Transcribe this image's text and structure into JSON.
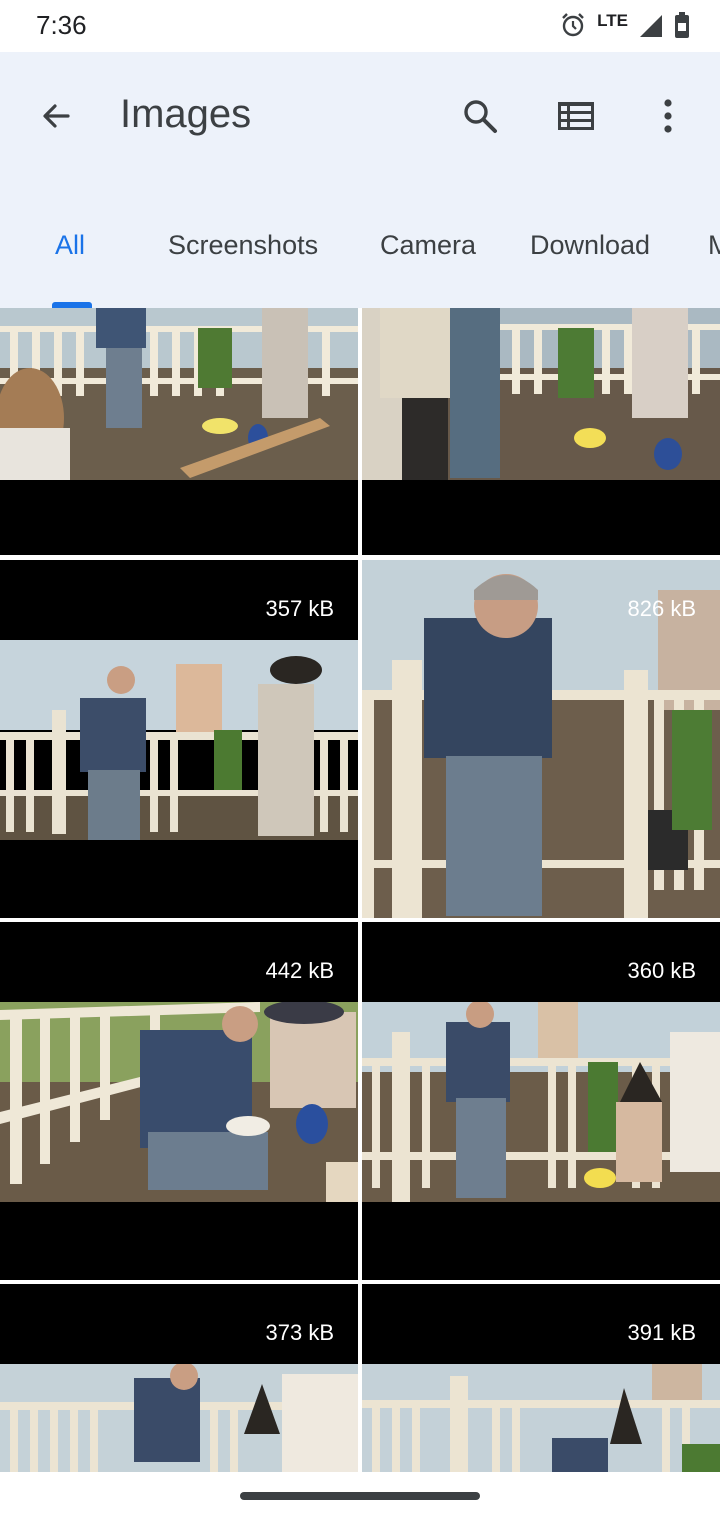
{
  "status_bar": {
    "time": "7:36",
    "network": "LTE"
  },
  "app_bar": {
    "title": "Images",
    "icons": [
      "back-arrow-icon",
      "search-icon",
      "list-view-icon",
      "more-vert-icon"
    ]
  },
  "tabs": [
    {
      "label": "All",
      "active": true
    },
    {
      "label": "Screenshots",
      "active": false
    },
    {
      "label": "Camera",
      "active": false
    },
    {
      "label": "Download",
      "active": false
    },
    {
      "label": "M",
      "active": false
    }
  ],
  "images": [
    {
      "size": ""
    },
    {
      "size": ""
    },
    {
      "size": "357 kB"
    },
    {
      "size": "826 kB"
    },
    {
      "size": "442 kB"
    },
    {
      "size": "360 kB"
    },
    {
      "size": "373 kB"
    },
    {
      "size": "391 kB"
    }
  ],
  "colors": {
    "accent": "#1a73e8",
    "header_bg": "#edf2fa",
    "text": "#3c4043"
  }
}
